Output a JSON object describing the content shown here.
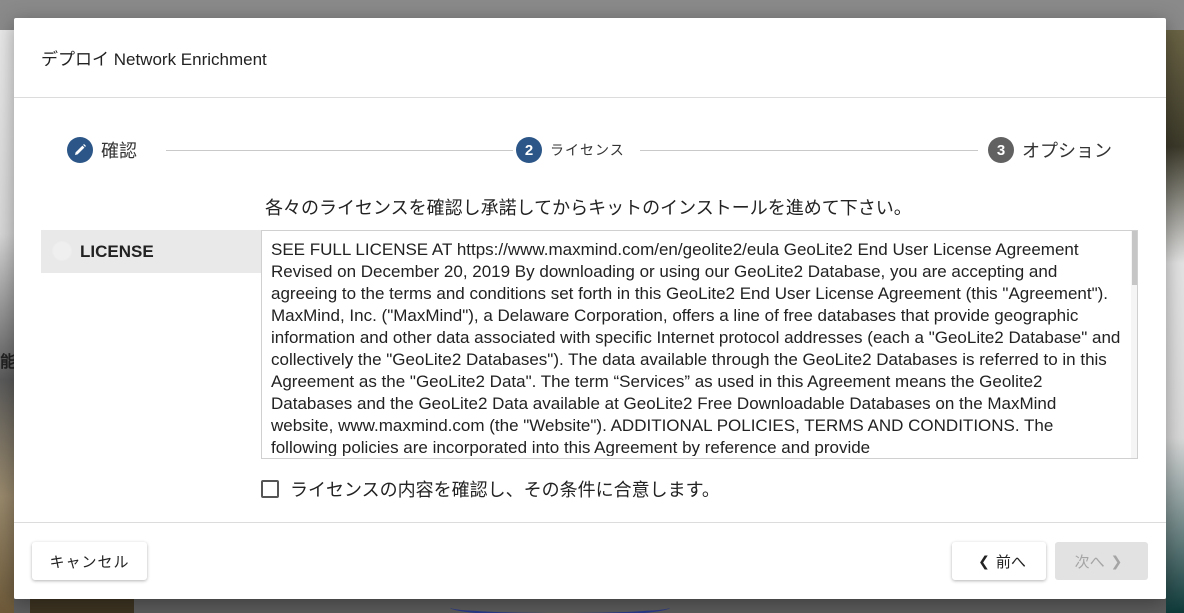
{
  "modal": {
    "title": "デプロイ Network Enrichment"
  },
  "stepper": {
    "steps": [
      {
        "label": "確認",
        "icon": "pencil-icon",
        "state": "done",
        "color": "#2b5687"
      },
      {
        "label": "ライセンス",
        "number": "2",
        "state": "active",
        "color": "#2b5687"
      },
      {
        "label": "オプション",
        "number": "3",
        "state": "pending",
        "color": "#616161"
      }
    ]
  },
  "instruction": "各々のライセンスを確認し承諾してからキットのインストールを進めて下さい。",
  "license": {
    "tab_label": "LICENSE",
    "text": "SEE FULL LICENSE AT https://www.maxmind.com/en/geolite2/eula GeoLite2 End User License Agreement Revised on December 20, 2019 By downloading or using our GeoLite2 Database, you are accepting and agreeing to the terms and conditions set forth in this GeoLite2 End User License Agreement (this \"Agreement\"). MaxMind, Inc. (\"MaxMind\"), a Delaware Corporation, offers a line of free databases that provide geographic information and other data associated with specific Internet protocol addresses (each a \"GeoLite2 Database\" and collectively the \"GeoLite2 Databases\"). The data available through the GeoLite2 Databases is referred to in this Agreement as the \"GeoLite2 Data\". The term “Services” as used in this Agreement means the Geolite2 Databases and the GeoLite2 Data available at GeoLite2 Free Downloadable Databases on the MaxMind website, www.maxmind.com (the \"Website\"). ADDITIONAL POLICIES, TERMS AND CONDITIONS. The following policies are incorporated into this Agreement by reference and provide"
  },
  "agree": {
    "label": "ライセンスの内容を確認し、その条件に合意します。",
    "checked": false
  },
  "footer": {
    "cancel_label": "キャンセル",
    "prev_label": "前へ",
    "next_label": "次へ",
    "next_disabled": true
  },
  "background": {
    "side_glyph": "能"
  }
}
